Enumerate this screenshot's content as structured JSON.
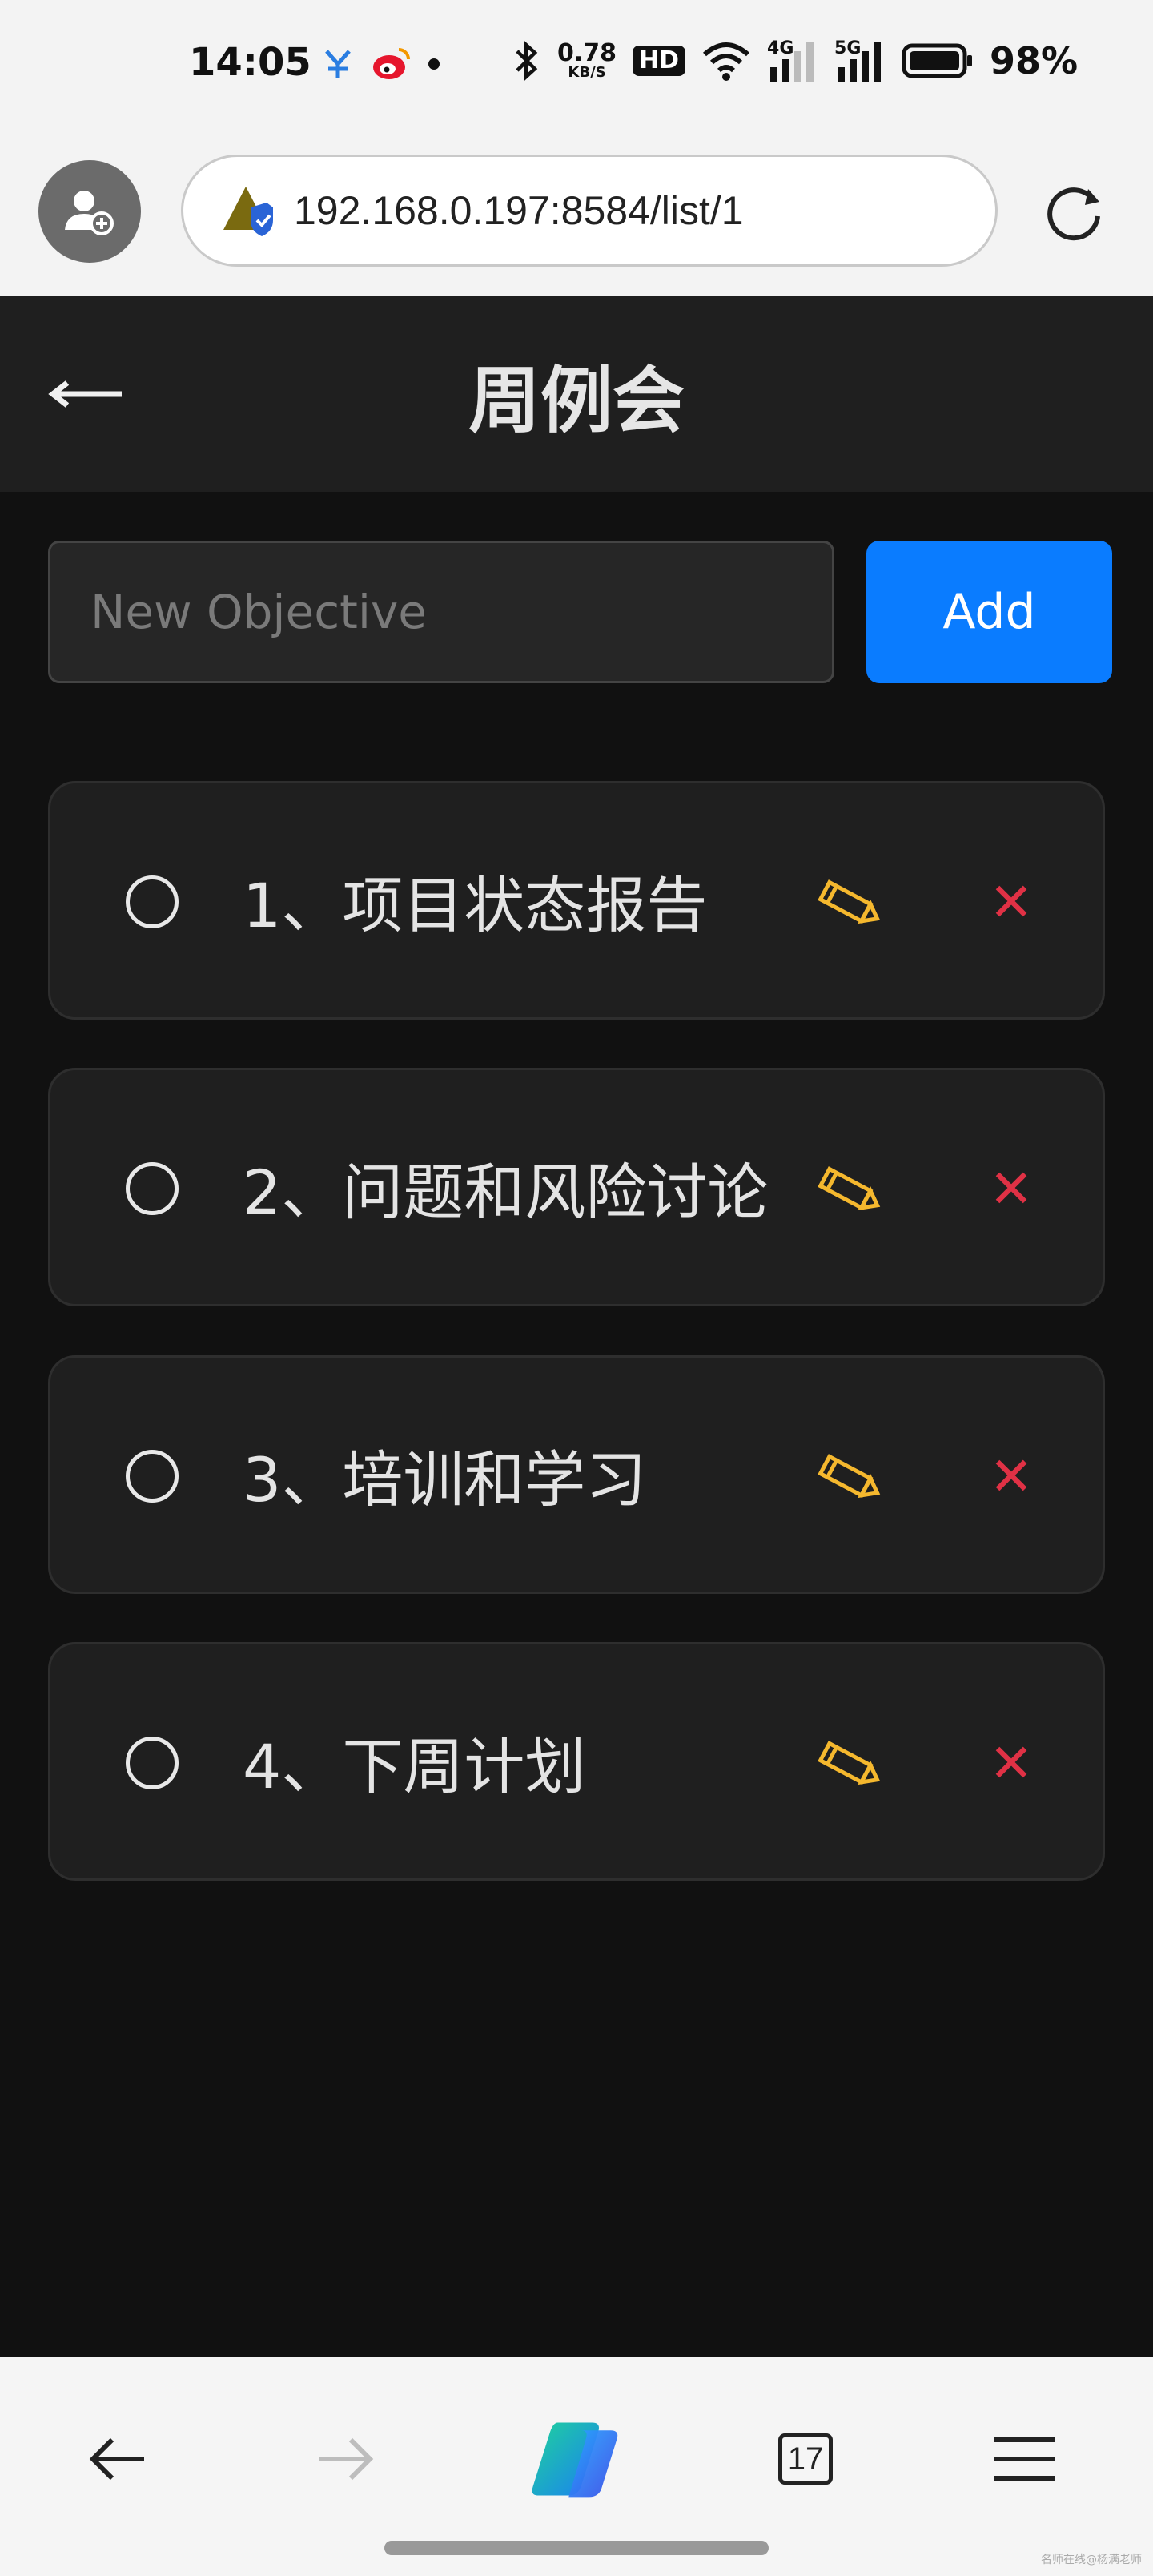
{
  "status_bar": {
    "time": "14:05",
    "net_speed_value": "0.78",
    "net_speed_unit": "KB/S",
    "hd_label": "HD",
    "signal_4g": "4G",
    "signal_5g": "5G",
    "battery": "98%"
  },
  "browser": {
    "url": "192.168.0.197:8584/list/1",
    "tab_count": "17"
  },
  "header": {
    "title": "周例会"
  },
  "form": {
    "input_placeholder": "New Objective",
    "input_value": "",
    "add_label": "Add"
  },
  "objectives": [
    {
      "label": "1、项目状态报告",
      "done": false
    },
    {
      "label": "2、问题和风险讨论",
      "done": false
    },
    {
      "label": "3、培训和学习",
      "done": false
    },
    {
      "label": "4、下周计划",
      "done": false
    }
  ],
  "icons": {
    "edit": "pencil-icon",
    "delete": "close-icon",
    "back": "arrow-left-icon"
  },
  "colors": {
    "accent": "#0a7cff",
    "edit_icon": "#f5b82e",
    "delete_icon": "#e03145",
    "background": "#111111",
    "card": "#1f1f1f"
  },
  "watermark": "名师在线@杨满老师"
}
